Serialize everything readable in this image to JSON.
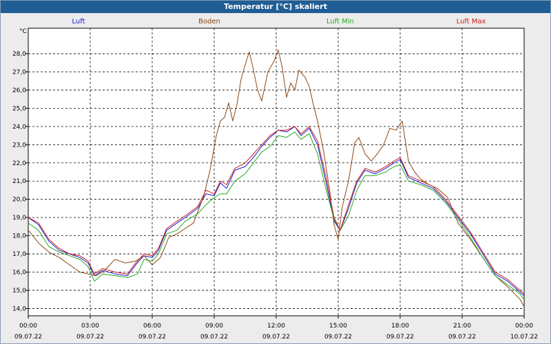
{
  "window": {
    "title": "Temperatur [°C] skaliert"
  },
  "chart_data": {
    "type": "line",
    "title": "Temperatur [°C] skaliert",
    "ylabel": "°C",
    "ylim": [
      13.6,
      29.4
    ],
    "xlim": [
      0,
      24
    ],
    "grid": true,
    "legend_position": "top",
    "y_ticks": [
      "14,0",
      "15,0",
      "16,0",
      "17,0",
      "18,0",
      "19,0",
      "20,0",
      "21,0",
      "22,0",
      "23,0",
      "24,0",
      "25,0",
      "26,0",
      "27,0",
      "28,0"
    ],
    "x_ticks": [
      {
        "time": "00:00",
        "date": "09.07.22"
      },
      {
        "time": "03:00",
        "date": "09.07.22"
      },
      {
        "time": "06:00",
        "date": "09.07.22"
      },
      {
        "time": "09:00",
        "date": "09.07.22"
      },
      {
        "time": "12:00",
        "date": "09.07.22"
      },
      {
        "time": "15:00",
        "date": "09.07.22"
      },
      {
        "time": "18:00",
        "date": "09.07.22"
      },
      {
        "time": "21:00",
        "date": "09.07.22"
      },
      {
        "time": "00:00",
        "date": "10.07.22"
      }
    ],
    "series": [
      {
        "name": "Luft",
        "color": "#1a1acc",
        "points": [
          [
            0,
            19.0
          ],
          [
            0.5,
            18.6
          ],
          [
            1,
            17.7
          ],
          [
            1.5,
            17.2
          ],
          [
            2,
            17.0
          ],
          [
            2.5,
            16.8
          ],
          [
            2.9,
            16.5
          ],
          [
            3.2,
            15.8
          ],
          [
            3.6,
            16.1
          ],
          [
            4.2,
            15.9
          ],
          [
            4.8,
            15.8
          ],
          [
            5.2,
            16.4
          ],
          [
            5.6,
            16.9
          ],
          [
            6,
            16.8
          ],
          [
            6.3,
            17.2
          ],
          [
            6.7,
            18.3
          ],
          [
            7.2,
            18.7
          ],
          [
            7.6,
            19.0
          ],
          [
            8.2,
            19.5
          ],
          [
            8.6,
            20.3
          ],
          [
            9.0,
            20.2
          ],
          [
            9.3,
            20.9
          ],
          [
            9.6,
            20.6
          ],
          [
            10.0,
            21.6
          ],
          [
            10.5,
            21.8
          ],
          [
            10.9,
            22.3
          ],
          [
            11.3,
            22.9
          ],
          [
            11.7,
            23.4
          ],
          [
            12.1,
            23.8
          ],
          [
            12.5,
            23.7
          ],
          [
            12.9,
            24.0
          ],
          [
            13.2,
            23.5
          ],
          [
            13.6,
            23.9
          ],
          [
            14.0,
            23.0
          ],
          [
            14.4,
            21.0
          ],
          [
            14.8,
            18.8
          ],
          [
            15.1,
            18.3
          ],
          [
            15.5,
            19.5
          ],
          [
            15.9,
            20.9
          ],
          [
            16.3,
            21.6
          ],
          [
            16.8,
            21.4
          ],
          [
            17.3,
            21.7
          ],
          [
            17.7,
            22.0
          ],
          [
            18.0,
            22.2
          ],
          [
            18.4,
            21.2
          ],
          [
            19.0,
            20.9
          ],
          [
            19.6,
            20.6
          ],
          [
            20.2,
            19.9
          ],
          [
            20.8,
            19.0
          ],
          [
            21.4,
            18.1
          ],
          [
            22.0,
            17.0
          ],
          [
            22.6,
            15.9
          ],
          [
            23.2,
            15.5
          ],
          [
            23.8,
            14.9
          ],
          [
            24,
            14.7
          ]
        ]
      },
      {
        "name": "Boden",
        "color": "#8b4513",
        "points": [
          [
            0,
            18.3
          ],
          [
            0.5,
            17.6
          ],
          [
            1,
            17.1
          ],
          [
            1.5,
            16.8
          ],
          [
            2,
            16.4
          ],
          [
            2.5,
            16.0
          ],
          [
            2.9,
            15.9
          ],
          [
            3.3,
            15.8
          ],
          [
            3.7,
            16.1
          ],
          [
            4.2,
            16.7
          ],
          [
            4.7,
            16.5
          ],
          [
            5.2,
            16.6
          ],
          [
            5.6,
            16.9
          ],
          [
            6.0,
            16.4
          ],
          [
            6.4,
            16.8
          ],
          [
            6.8,
            17.9
          ],
          [
            7.2,
            18.1
          ],
          [
            7.6,
            18.4
          ],
          [
            8.0,
            18.7
          ],
          [
            8.5,
            20.2
          ],
          [
            8.8,
            21.6
          ],
          [
            9.1,
            23.5
          ],
          [
            9.3,
            24.3
          ],
          [
            9.5,
            24.5
          ],
          [
            9.7,
            25.3
          ],
          [
            9.9,
            24.3
          ],
          [
            10.1,
            25.2
          ],
          [
            10.3,
            26.6
          ],
          [
            10.5,
            27.4
          ],
          [
            10.7,
            28.1
          ],
          [
            10.9,
            27.1
          ],
          [
            11.1,
            26.0
          ],
          [
            11.3,
            25.4
          ],
          [
            11.6,
            27.0
          ],
          [
            11.9,
            27.6
          ],
          [
            12.1,
            28.2
          ],
          [
            12.3,
            27.2
          ],
          [
            12.5,
            25.6
          ],
          [
            12.7,
            26.4
          ],
          [
            12.9,
            26.0
          ],
          [
            13.1,
            27.1
          ],
          [
            13.4,
            26.7
          ],
          [
            13.6,
            26.2
          ],
          [
            13.8,
            25.2
          ],
          [
            14.0,
            24.3
          ],
          [
            14.3,
            22.6
          ],
          [
            14.6,
            20.4
          ],
          [
            14.8,
            18.6
          ],
          [
            15.0,
            17.8
          ],
          [
            15.2,
            19.6
          ],
          [
            15.5,
            21.0
          ],
          [
            15.8,
            23.1
          ],
          [
            16.0,
            23.4
          ],
          [
            16.3,
            22.5
          ],
          [
            16.6,
            22.1
          ],
          [
            16.9,
            22.5
          ],
          [
            17.2,
            23.0
          ],
          [
            17.5,
            23.9
          ],
          [
            17.8,
            23.8
          ],
          [
            18.1,
            24.3
          ],
          [
            18.4,
            22.1
          ],
          [
            18.7,
            21.5
          ],
          [
            19.0,
            21.1
          ],
          [
            19.4,
            20.8
          ],
          [
            19.8,
            20.6
          ],
          [
            20.3,
            20.1
          ],
          [
            20.8,
            18.7
          ],
          [
            21.4,
            17.8
          ],
          [
            22.0,
            16.8
          ],
          [
            22.6,
            15.8
          ],
          [
            23.2,
            15.2
          ],
          [
            23.8,
            14.5
          ],
          [
            24,
            14.1
          ]
        ]
      },
      {
        "name": "Luft Min",
        "color": "#22aa22",
        "points": [
          [
            0,
            18.7
          ],
          [
            0.5,
            18.3
          ],
          [
            1,
            17.4
          ],
          [
            1.5,
            17.1
          ],
          [
            2,
            16.9
          ],
          [
            2.5,
            16.7
          ],
          [
            2.9,
            16.3
          ],
          [
            3.2,
            15.5
          ],
          [
            3.6,
            15.9
          ],
          [
            4.2,
            15.8
          ],
          [
            4.8,
            15.7
          ],
          [
            5.3,
            15.9
          ],
          [
            5.6,
            16.7
          ],
          [
            6.0,
            16.6
          ],
          [
            6.3,
            17.0
          ],
          [
            6.7,
            18.1
          ],
          [
            7.2,
            18.3
          ],
          [
            7.6,
            18.8
          ],
          [
            8.2,
            19.2
          ],
          [
            8.6,
            19.7
          ],
          [
            9.0,
            20.1
          ],
          [
            9.3,
            20.3
          ],
          [
            9.6,
            20.3
          ],
          [
            10.0,
            21.0
          ],
          [
            10.5,
            21.4
          ],
          [
            10.9,
            22.0
          ],
          [
            11.3,
            22.6
          ],
          [
            11.7,
            22.9
          ],
          [
            12.1,
            23.5
          ],
          [
            12.5,
            23.4
          ],
          [
            12.9,
            23.7
          ],
          [
            13.2,
            23.3
          ],
          [
            13.6,
            23.6
          ],
          [
            14.0,
            22.5
          ],
          [
            14.4,
            20.6
          ],
          [
            14.8,
            18.9
          ],
          [
            15.1,
            18.3
          ],
          [
            15.5,
            19.1
          ],
          [
            15.9,
            20.5
          ],
          [
            16.3,
            21.3
          ],
          [
            16.8,
            21.3
          ],
          [
            17.3,
            21.5
          ],
          [
            17.7,
            21.8
          ],
          [
            18.0,
            21.9
          ],
          [
            18.4,
            21.0
          ],
          [
            19.0,
            20.8
          ],
          [
            19.6,
            20.5
          ],
          [
            20.2,
            19.8
          ],
          [
            20.8,
            18.9
          ],
          [
            21.4,
            17.9
          ],
          [
            22.0,
            16.8
          ],
          [
            22.6,
            15.8
          ],
          [
            23.2,
            15.3
          ],
          [
            23.8,
            14.8
          ],
          [
            24,
            14.5
          ]
        ]
      },
      {
        "name": "Luft Max",
        "color": "#cc1a1a",
        "points": [
          [
            0,
            19.0
          ],
          [
            0.5,
            18.7
          ],
          [
            1,
            17.8
          ],
          [
            1.5,
            17.3
          ],
          [
            2,
            17.0
          ],
          [
            2.5,
            16.9
          ],
          [
            2.9,
            16.6
          ],
          [
            3.2,
            15.9
          ],
          [
            3.6,
            16.2
          ],
          [
            4.2,
            16.0
          ],
          [
            4.8,
            15.9
          ],
          [
            5.2,
            16.5
          ],
          [
            5.6,
            17.0
          ],
          [
            6.0,
            16.9
          ],
          [
            6.3,
            17.3
          ],
          [
            6.7,
            18.4
          ],
          [
            7.2,
            18.8
          ],
          [
            7.6,
            19.1
          ],
          [
            8.2,
            19.6
          ],
          [
            8.6,
            20.5
          ],
          [
            9.0,
            20.3
          ],
          [
            9.3,
            21.0
          ],
          [
            9.6,
            20.8
          ],
          [
            10.0,
            21.7
          ],
          [
            10.5,
            22.0
          ],
          [
            10.9,
            22.5
          ],
          [
            11.3,
            23.0
          ],
          [
            11.7,
            23.5
          ],
          [
            12.1,
            23.8
          ],
          [
            12.5,
            23.8
          ],
          [
            12.9,
            24.0
          ],
          [
            13.2,
            23.6
          ],
          [
            13.6,
            24.0
          ],
          [
            14.0,
            23.2
          ],
          [
            14.4,
            21.3
          ],
          [
            14.8,
            19.0
          ],
          [
            15.1,
            18.3
          ],
          [
            15.5,
            19.7
          ],
          [
            15.9,
            21.0
          ],
          [
            16.3,
            21.7
          ],
          [
            16.8,
            21.5
          ],
          [
            17.3,
            21.8
          ],
          [
            17.7,
            22.1
          ],
          [
            18.0,
            22.3
          ],
          [
            18.4,
            21.3
          ],
          [
            19.0,
            21.0
          ],
          [
            19.6,
            20.7
          ],
          [
            20.2,
            20.0
          ],
          [
            20.8,
            19.1
          ],
          [
            21.4,
            18.2
          ],
          [
            22.0,
            17.1
          ],
          [
            22.6,
            16.0
          ],
          [
            23.2,
            15.6
          ],
          [
            23.8,
            15.0
          ],
          [
            24,
            14.8
          ]
        ]
      }
    ]
  }
}
